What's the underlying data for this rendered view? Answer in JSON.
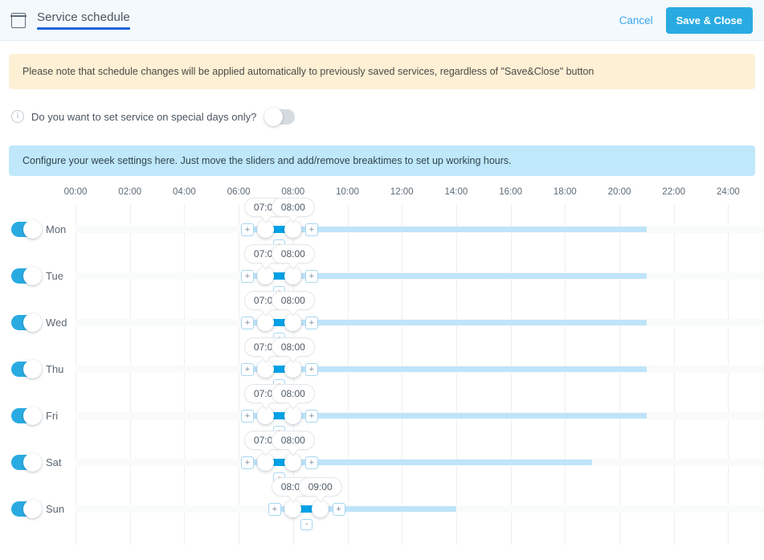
{
  "header": {
    "calendar_icon": "calendar-icon",
    "title": "Service schedule",
    "cancel_label": "Cancel",
    "save_label": "Save & Close"
  },
  "warning_banner": {
    "text": "Please note that schedule changes will be applied automatically to previously saved services, regardless of \"Save&Close\" button",
    "bg": "#fdf0d5"
  },
  "special_days": {
    "info_icon": "info-circle-icon",
    "info_glyph": "i",
    "label": "Do you want to set service on special days only?",
    "toggle_on": false
  },
  "info_banner": {
    "text": "Configure your week settings here. Just move the sliders and add/remove breaktimes to set up working hours.",
    "bg": "#bfe8fa"
  },
  "schedule": {
    "axis_labels": [
      "00:00",
      "02:00",
      "04:00",
      "06:00",
      "08:00",
      "10:00",
      "12:00",
      "14:00",
      "16:00",
      "18:00",
      "20:00",
      "22:00",
      "24:00"
    ],
    "axis_start_hour": 0,
    "axis_end_hour": 24,
    "add_button_label": "+",
    "remove_button_label": "-",
    "colors": {
      "active_segment": "#00a2e8",
      "open_track": "#bfe4f9",
      "toggle_on": "#29abe2",
      "accent": "#1565d8"
    },
    "days": [
      {
        "name": "Mon",
        "enabled": true,
        "break_start": "07:00",
        "break_end": "08:00",
        "break_start_hour": 7,
        "break_end_hour": 8,
        "open_end_hour": 21
      },
      {
        "name": "Tue",
        "enabled": true,
        "break_start": "07:00",
        "break_end": "08:00",
        "break_start_hour": 7,
        "break_end_hour": 8,
        "open_end_hour": 21
      },
      {
        "name": "Wed",
        "enabled": true,
        "break_start": "07:00",
        "break_end": "08:00",
        "break_start_hour": 7,
        "break_end_hour": 8,
        "open_end_hour": 21
      },
      {
        "name": "Thu",
        "enabled": true,
        "break_start": "07:00",
        "break_end": "08:00",
        "break_start_hour": 7,
        "break_end_hour": 8,
        "open_end_hour": 21
      },
      {
        "name": "Fri",
        "enabled": true,
        "break_start": "07:00",
        "break_end": "08:00",
        "break_start_hour": 7,
        "break_end_hour": 8,
        "open_end_hour": 21
      },
      {
        "name": "Sat",
        "enabled": true,
        "break_start": "07:00",
        "break_end": "08:00",
        "break_start_hour": 7,
        "break_end_hour": 8,
        "open_end_hour": 19
      },
      {
        "name": "Sun",
        "enabled": true,
        "break_start": "08:00",
        "break_end": "09:00",
        "break_start_hour": 8,
        "break_end_hour": 9,
        "open_end_hour": 14
      }
    ]
  }
}
